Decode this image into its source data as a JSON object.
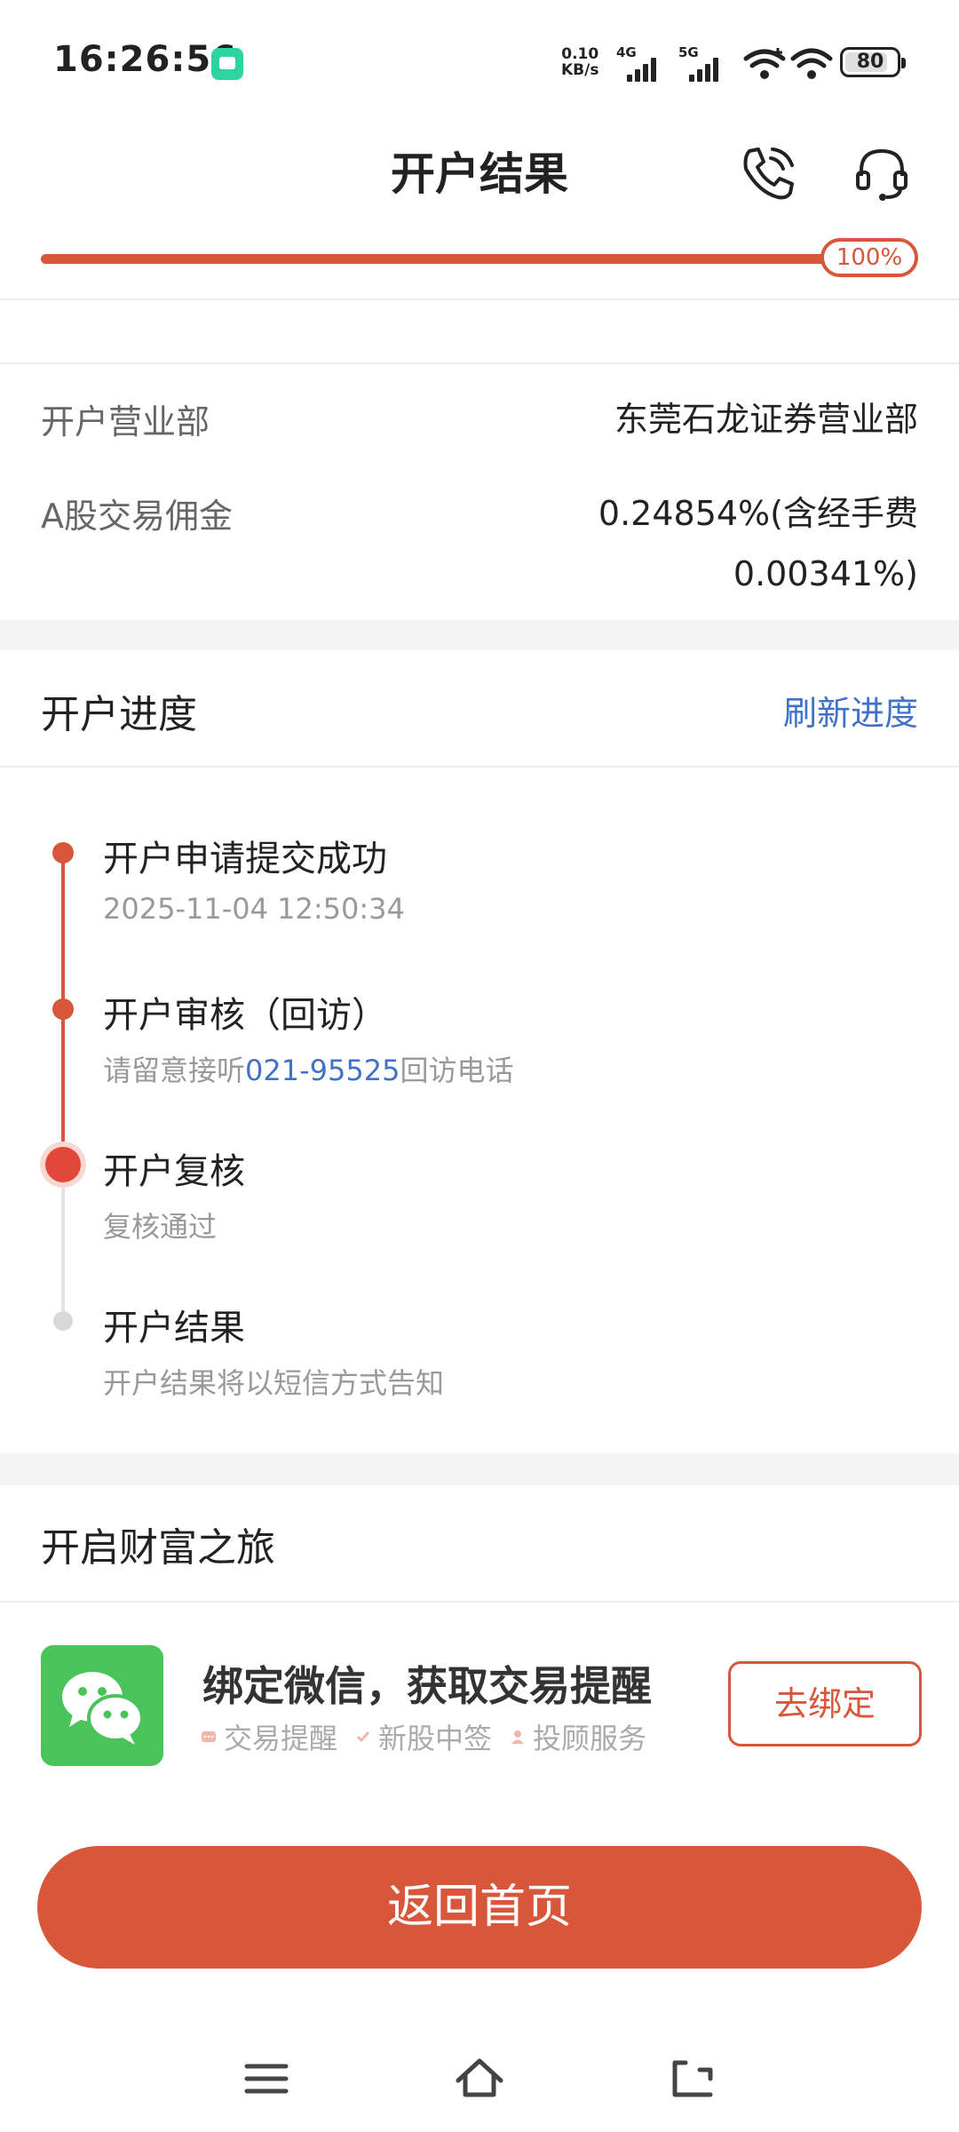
{
  "status_bar": {
    "time": "16:26:56",
    "net_speed_value": "0.10",
    "net_speed_unit": "KB/s",
    "sim1_label": "4G",
    "sim2_label": "5G",
    "battery": "80"
  },
  "header": {
    "title": "开户结果",
    "progress_label": "100%",
    "progress_percent": 100
  },
  "info": {
    "branch_label": "开户营业部",
    "branch_value": "东莞石龙证券营业部",
    "commission_label": "A股交易佣金",
    "commission_value_line1": "0.24854%(含经手费",
    "commission_value_line2": "0.00341%)"
  },
  "progress_section": {
    "title": "开户进度",
    "refresh_label": "刷新进度",
    "steps": [
      {
        "title": "开户申请提交成功",
        "sub": "2025-11-04 12:50:34",
        "state": "done"
      },
      {
        "title": "开户审核（回访）",
        "sub_prefix": "请留意接听",
        "sub_phone": "021-95525",
        "sub_suffix": "回访电话",
        "state": "done"
      },
      {
        "title": "开户复核",
        "sub": "复核通过",
        "state": "current"
      },
      {
        "title": "开户结果",
        "sub": "开户结果将以短信方式告知",
        "state": "pending"
      }
    ]
  },
  "wealth_section": {
    "title": "开启财富之旅",
    "wechat_title": "绑定微信，获取交易提醒",
    "tags": [
      "交易提醒",
      "新股中签",
      "投顾服务"
    ],
    "bind_label": "去绑定"
  },
  "home_button_label": "返回首页",
  "colors": {
    "accent": "#d8563a",
    "link": "#3f72c8",
    "wechat": "#4ac35a"
  }
}
